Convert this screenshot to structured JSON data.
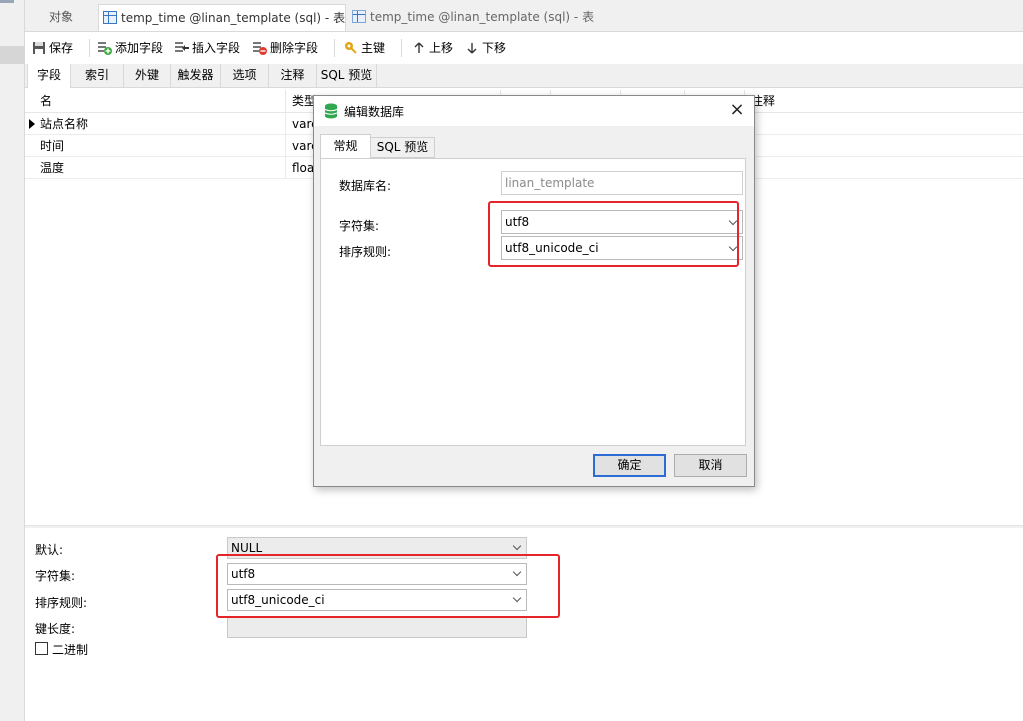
{
  "tabs": [
    {
      "label": "对象"
    },
    {
      "label": "temp_time @linan_template (sql) - 表"
    },
    {
      "label": "temp_time @linan_template (sql) - 表"
    }
  ],
  "toolbar": {
    "save": "保存",
    "add_field": "添加字段",
    "insert_field": "插入字段",
    "delete_field": "删除字段",
    "primary_key": "主键",
    "move_up": "上移",
    "move_down": "下移"
  },
  "subtabs": [
    "字段",
    "索引",
    "外键",
    "触发器",
    "选项",
    "注释",
    "SQL 预览"
  ],
  "grid": {
    "headers": {
      "name": "名",
      "type": "类型",
      "comment": "注释"
    },
    "rows": [
      {
        "name": "站点名称",
        "type": "varc"
      },
      {
        "name": "时间",
        "type": "varc"
      },
      {
        "name": "温度",
        "type": "floa"
      }
    ]
  },
  "props": {
    "default_label": "默认:",
    "default_value": "NULL",
    "charset_label": "字符集:",
    "charset_value": "utf8",
    "collation_label": "排序规则:",
    "collation_value": "utf8_unicode_ci",
    "keylen_label": "键长度:",
    "binary_label": "二进制"
  },
  "dialog": {
    "title": "编辑数据库",
    "close": "×",
    "tabs": [
      "常规",
      "SQL 预览"
    ],
    "db_name_label": "数据库名:",
    "db_name_value": "linan_template",
    "charset_label": "字符集:",
    "charset_value": "utf8",
    "collation_label": "排序规则:",
    "collation_value": "utf8_unicode_ci",
    "ok": "确定",
    "cancel": "取消"
  },
  "colors": {
    "highlight": "#e5252a",
    "accent": "#2c6cd4"
  }
}
